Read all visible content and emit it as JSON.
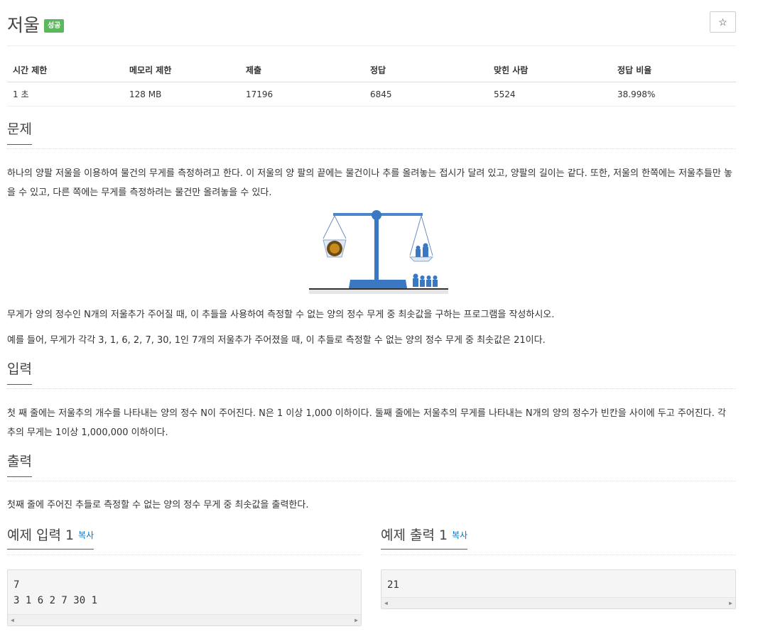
{
  "problem": {
    "title": "저울",
    "status_badge": "성공",
    "star_icon": "☆"
  },
  "info_table": {
    "headers": [
      "시간 제한",
      "메모리 제한",
      "제출",
      "정답",
      "맞힌 사람",
      "정답 비율"
    ],
    "row": [
      "1 초",
      "128 MB",
      "17196",
      "6845",
      "5524",
      "38.998%"
    ]
  },
  "sections": {
    "problem": {
      "heading": "문제",
      "paragraph1": "하나의 양팔 저울을 이용하여 물건의 무게를 측정하려고 한다. 이 저울의 양 팔의 끝에는 물건이나 추를 올려놓는 접시가 달려 있고, 양팔의 길이는 같다. 또한, 저울의 한쪽에는 저울추들만 놓을 수 있고, 다른 쪽에는 무게를 측정하려는 물건만 올려놓을 수 있다.",
      "paragraph2": "무게가 양의 정수인 N개의 저울추가 주어질 때, 이 추들을 사용하여 측정할 수 없는 양의 정수 무게 중 최솟값을 구하는 프로그램을 작성하시오.",
      "paragraph3": "예를 들어, 무게가 각각 3, 1, 6, 2, 7, 30, 1인 7개의 저울추가 주어졌을 때, 이 추들로 측정할 수 없는 양의 정수 무게 중 최솟값은 21이다."
    },
    "input": {
      "heading": "입력",
      "paragraph": "첫 째 줄에는 저울추의 개수를 나타내는 양의 정수 N이 주어진다. N은 1 이상 1,000 이하이다. 둘째 줄에는 저울추의 무게를 나타내는 N개의 양의 정수가 빈칸을 사이에 두고 주어진다. 각 추의 무게는 1이상 1,000,000 이하이다."
    },
    "output": {
      "heading": "출력",
      "paragraph": "첫째 줄에 주어진 추들로 측정할 수 없는 양의 정수 무게 중 최솟값을 출력한다."
    }
  },
  "samples": {
    "input": {
      "heading": "예제 입력 1",
      "copy_label": "복사",
      "lines": "7\n3 1 6 2 7 30 1"
    },
    "output": {
      "heading": "예제 출력 1",
      "copy_label": "복사",
      "lines": "21"
    }
  },
  "colors": {
    "accent": "#0076c0",
    "success": "#5cb85c",
    "scale_blue": "#3a78c3"
  }
}
